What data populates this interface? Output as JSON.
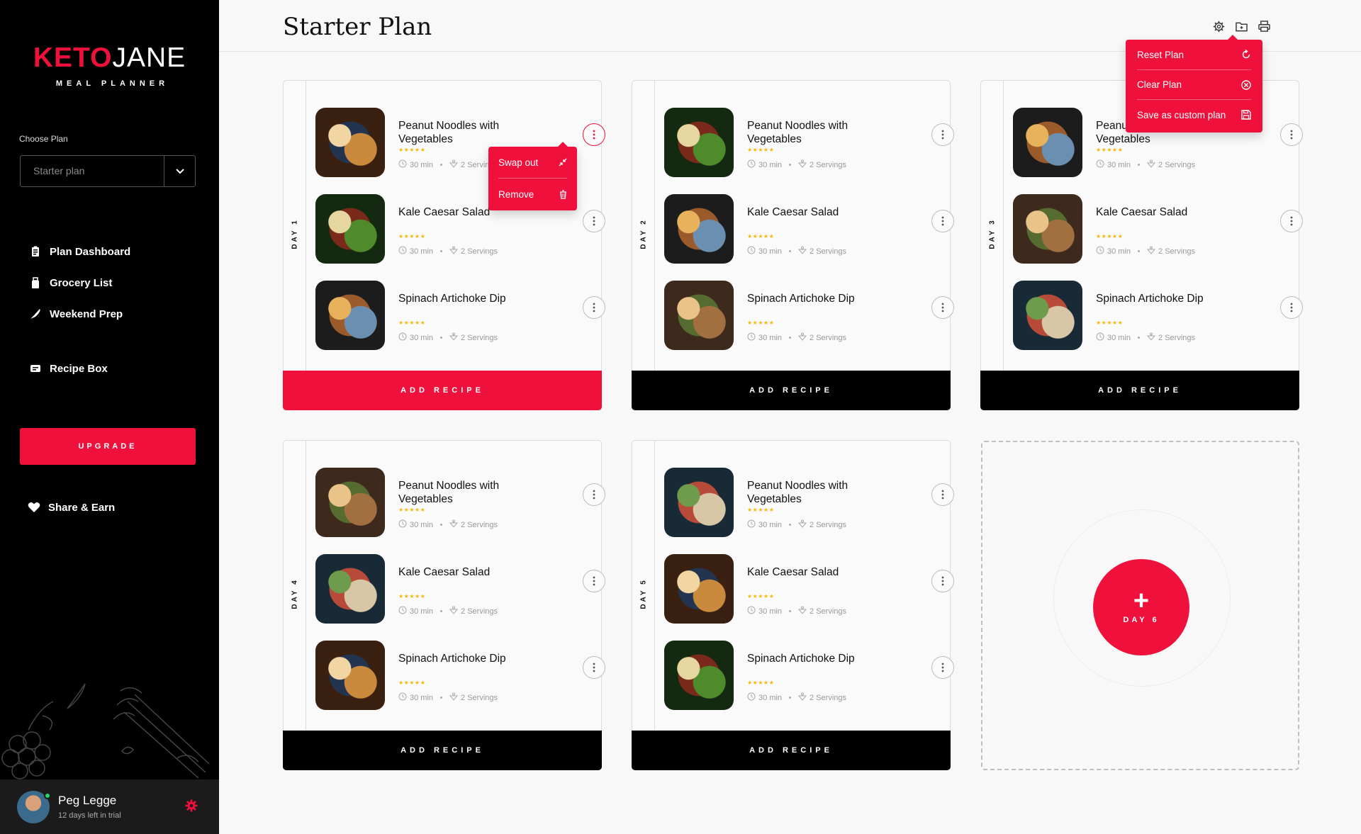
{
  "brand": {
    "keto": "KETO",
    "jane": "JANE",
    "sub": "MEAL PLANNER",
    "accent": "#f0103c"
  },
  "sidebar": {
    "choose_label": "Choose Plan",
    "plan_value": "Starter plan",
    "nav": [
      {
        "label": "Plan Dashboard",
        "icon": "clipboard-icon"
      },
      {
        "label": "Grocery List",
        "icon": "bag-icon"
      },
      {
        "label": "Weekend Prep",
        "icon": "knife-icon"
      },
      {
        "label": "Recipe Box",
        "icon": "recipe-box-icon"
      }
    ],
    "upgrade": "UPGRADE",
    "share": "Share & Earn"
  },
  "user": {
    "name": "Peg Legge",
    "trial": "12 days left in trial"
  },
  "header": {
    "title": "Starter Plan"
  },
  "settings_menu": [
    {
      "label": "Reset Plan",
      "icon": "reset-icon"
    },
    {
      "label": "Clear Plan",
      "icon": "clear-icon"
    },
    {
      "label": "Save as custom plan",
      "icon": "save-icon"
    }
  ],
  "recipe_menu": [
    {
      "label": "Swap out",
      "icon": "swap-icon"
    },
    {
      "label": "Remove",
      "icon": "trash-icon"
    }
  ],
  "days": [
    {
      "label": "DAY 1",
      "add": "ADD RECIPE",
      "recipes": [
        {
          "title": "Peanut Noodles with Vegetables",
          "stars": "★★★★★",
          "time": "30 min",
          "servings": "2 Servings"
        },
        {
          "title": "Kale Caesar Salad",
          "stars": "★★★★★",
          "time": "30 min",
          "servings": "2 Servings"
        },
        {
          "title": "Spinach Artichoke Dip",
          "stars": "★★★★★",
          "time": "30 min",
          "servings": "2 Servings"
        }
      ]
    },
    {
      "label": "DAY 2",
      "add": "ADD RECIPE",
      "recipes": [
        {
          "title": "Peanut Noodles with Vegetables",
          "stars": "★★★★★",
          "time": "30 min",
          "servings": "2 Servings"
        },
        {
          "title": "Kale Caesar Salad",
          "stars": "★★★★★",
          "time": "30 min",
          "servings": "2 Servings"
        },
        {
          "title": "Spinach Artichoke Dip",
          "stars": "★★★★★",
          "time": "30 min",
          "servings": "2 Servings"
        }
      ]
    },
    {
      "label": "DAY 3",
      "add": "ADD RECIPE",
      "recipes": [
        {
          "title": "Peanut Noodles with Vegetables",
          "stars": "★★★★★",
          "time": "30 min",
          "servings": "2 Servings"
        },
        {
          "title": "Kale Caesar Salad",
          "stars": "★★★★★",
          "time": "30 min",
          "servings": "2 Servings"
        },
        {
          "title": "Spinach Artichoke Dip",
          "stars": "★★★★★",
          "time": "30 min",
          "servings": "2 Servings"
        }
      ]
    },
    {
      "label": "DAY 4",
      "add": "ADD RECIPE",
      "recipes": [
        {
          "title": "Peanut Noodles with Vegetables",
          "stars": "★★★★★",
          "time": "30 min",
          "servings": "2 Servings"
        },
        {
          "title": "Kale Caesar Salad",
          "stars": "★★★★★",
          "time": "30 min",
          "servings": "2 Servings"
        },
        {
          "title": "Spinach Artichoke Dip",
          "stars": "★★★★★",
          "time": "30 min",
          "servings": "2 Servings"
        }
      ]
    },
    {
      "label": "DAY 5",
      "add": "ADD RECIPE",
      "recipes": [
        {
          "title": "Peanut Noodles with Vegetables",
          "stars": "★★★★★",
          "time": "30 min",
          "servings": "2 Servings"
        },
        {
          "title": "Kale Caesar Salad",
          "stars": "★★★★★",
          "time": "30 min",
          "servings": "2 Servings"
        },
        {
          "title": "Spinach Artichoke Dip",
          "stars": "★★★★★",
          "time": "30 min",
          "servings": "2 Servings"
        }
      ]
    }
  ],
  "add_day": {
    "plus": "+",
    "label": "DAY 6"
  }
}
